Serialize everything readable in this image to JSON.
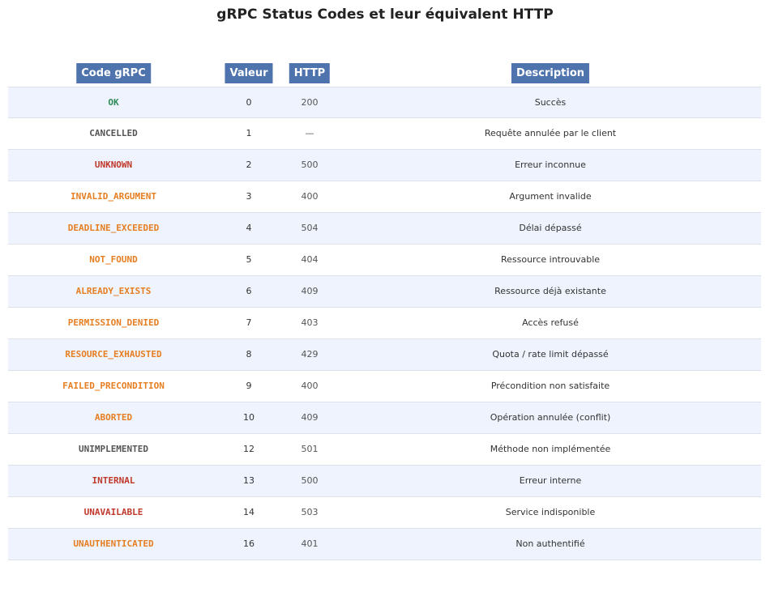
{
  "chart_data": {
    "type": "table",
    "title": "gRPC Status Codes et leur équivalent HTTP",
    "columns": [
      "Code gRPC",
      "Valeur",
      "HTTP",
      "Description"
    ],
    "rows": [
      {
        "code": "OK",
        "value": "0",
        "http": "200",
        "description": "Succès",
        "color": "#2e8b57"
      },
      {
        "code": "CANCELLED",
        "value": "1",
        "http": "—",
        "description": "Requête annulée par le client",
        "color": "#555555"
      },
      {
        "code": "UNKNOWN",
        "value": "2",
        "http": "500",
        "description": "Erreur inconnue",
        "color": "#c0392b"
      },
      {
        "code": "INVALID_ARGUMENT",
        "value": "3",
        "http": "400",
        "description": "Argument invalide",
        "color": "#e67e22"
      },
      {
        "code": "DEADLINE_EXCEEDED",
        "value": "4",
        "http": "504",
        "description": "Délai dépassé",
        "color": "#e67e22"
      },
      {
        "code": "NOT_FOUND",
        "value": "5",
        "http": "404",
        "description": "Ressource introuvable",
        "color": "#e67e22"
      },
      {
        "code": "ALREADY_EXISTS",
        "value": "6",
        "http": "409",
        "description": "Ressource déjà existante",
        "color": "#e67e22"
      },
      {
        "code": "PERMISSION_DENIED",
        "value": "7",
        "http": "403",
        "description": "Accès refusé",
        "color": "#e67e22"
      },
      {
        "code": "RESOURCE_EXHAUSTED",
        "value": "8",
        "http": "429",
        "description": "Quota / rate limit dépassé",
        "color": "#e67e22"
      },
      {
        "code": "FAILED_PRECONDITION",
        "value": "9",
        "http": "400",
        "description": "Précondition non satisfaite",
        "color": "#e67e22"
      },
      {
        "code": "ABORTED",
        "value": "10",
        "http": "409",
        "description": "Opération annulée (conflit)",
        "color": "#e67e22"
      },
      {
        "code": "UNIMPLEMENTED",
        "value": "12",
        "http": "501",
        "description": "Méthode non implémentée",
        "color": "#555555"
      },
      {
        "code": "INTERNAL",
        "value": "13",
        "http": "500",
        "description": "Erreur interne",
        "color": "#c0392b"
      },
      {
        "code": "UNAVAILABLE",
        "value": "14",
        "http": "503",
        "description": "Service indisponible",
        "color": "#c0392b"
      },
      {
        "code": "UNAUTHENTICATED",
        "value": "16",
        "http": "401",
        "description": "Non authentifié",
        "color": "#e67e22"
      }
    ],
    "colors": {
      "header_bg": "#4f73ad",
      "header_text": "#ffffff",
      "row_alt_bg": "#eef3fd",
      "row_bg": "#ffffff",
      "grid_line": "#dde1ea"
    }
  }
}
